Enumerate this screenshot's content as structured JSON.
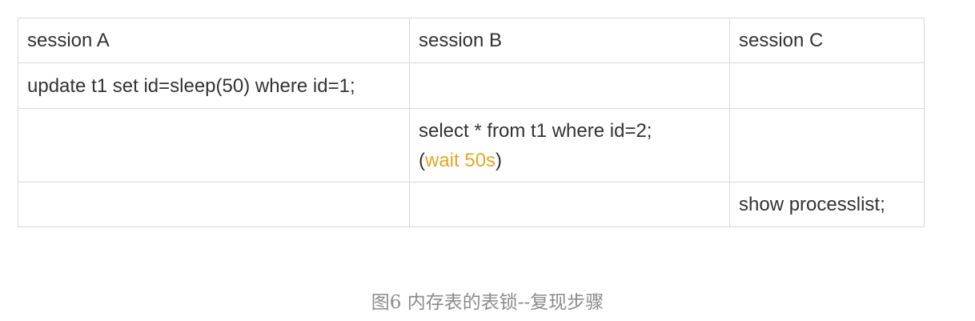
{
  "table": {
    "headers": [
      "session A",
      "session B",
      "session C"
    ],
    "rows": [
      {
        "a": "update t1 set id=sleep(50) where id=1;",
        "b": "",
        "c": ""
      },
      {
        "a": "",
        "b_line1": "select * from t1 where id=2;",
        "b_open": "(",
        "b_highlight": "wait 50s",
        "b_close": ")",
        "c": ""
      },
      {
        "a": "",
        "b": "",
        "c": "show processlist;"
      }
    ]
  },
  "caption": "图6 内存表的表锁--复现步骤",
  "colors": {
    "highlight": "#e5a823",
    "text": "#333333",
    "border": "#d9d9d9",
    "caption": "#8c8c8c"
  }
}
